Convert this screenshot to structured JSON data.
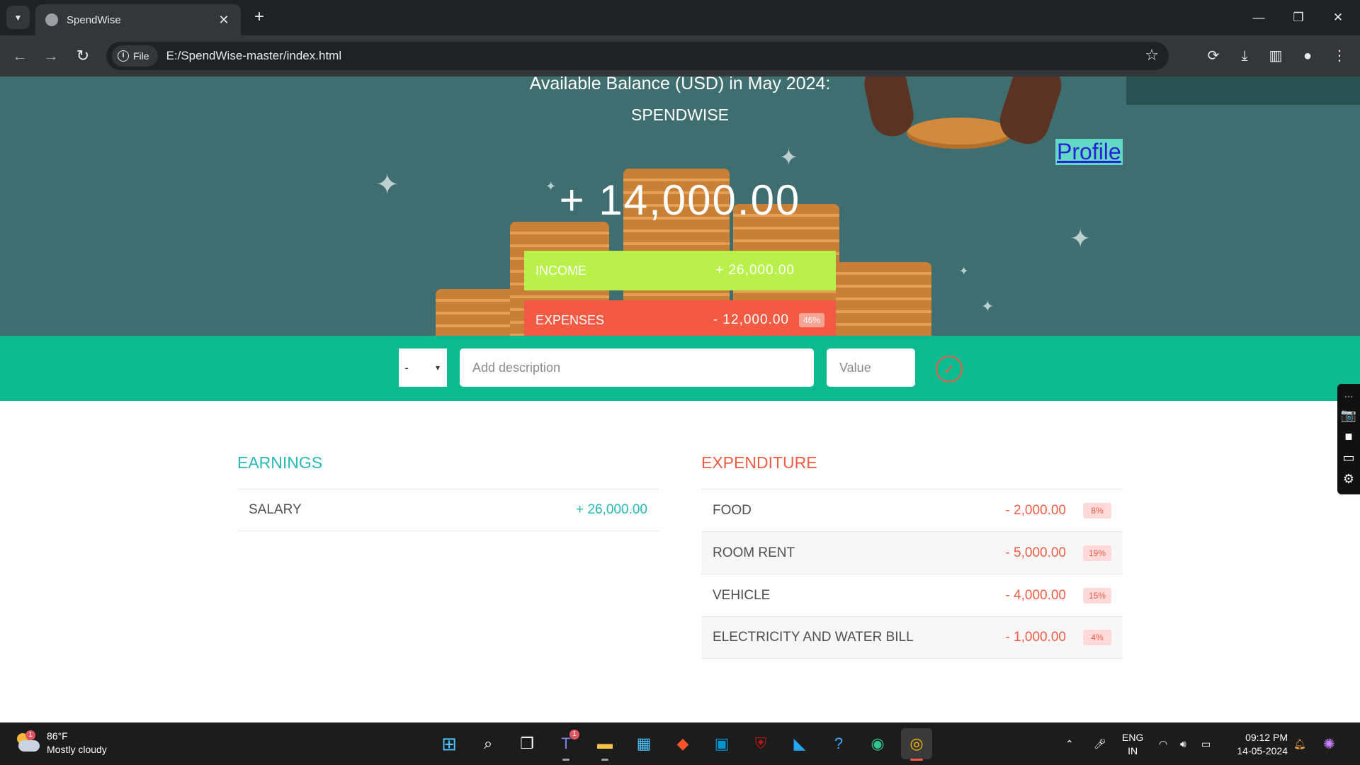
{
  "browser": {
    "tab_title": "SpendWise",
    "tab_close": "✕",
    "new_tab": "+",
    "site_chip": "File",
    "url": "E:/SpendWise-master/index.html"
  },
  "hero": {
    "balance_title": "Available Balance (USD) in May 2024:",
    "brand": "SPENDWISE",
    "balance_value": "+ 14,000.00",
    "profile_link": "Profile",
    "income_label": "INCOME",
    "income_value": "+ 26,000.00",
    "expenses_label": "EXPENSES",
    "expenses_value": "- 12,000.00",
    "expenses_percent": "46%"
  },
  "add_form": {
    "type_value": "-",
    "description_placeholder": "Add description",
    "value_placeholder": "Value"
  },
  "earnings": {
    "heading": "EARNINGS",
    "items": [
      {
        "description": "SALARY",
        "amount": "+ 26,000.00"
      }
    ]
  },
  "expenditure": {
    "heading": "EXPENDITURE",
    "items": [
      {
        "description": "FOOD",
        "amount": "- 2,000.00",
        "percent": "8%"
      },
      {
        "description": "ROOM RENT",
        "amount": "- 5,000.00",
        "percent": "19%"
      },
      {
        "description": "VEHICLE",
        "amount": "- 4,000.00",
        "percent": "15%"
      },
      {
        "description": "ELECTRICITY AND WATER BILL",
        "amount": "- 1,000.00",
        "percent": "4%"
      }
    ]
  },
  "taskbar": {
    "weather_temp": "86°F",
    "weather_desc": "Mostly cloudy",
    "weather_badge": "1",
    "teams_badge": "1",
    "lang_line1": "ENG",
    "lang_line2": "IN",
    "time": "09:12 PM",
    "date": "14-05-2024"
  },
  "colors": {
    "hero_bg": "#3e6e6f",
    "income": "#b9f04a",
    "expense": "#f25a43",
    "add_bar": "#0cba8f",
    "income_text": "#28b9b5"
  }
}
